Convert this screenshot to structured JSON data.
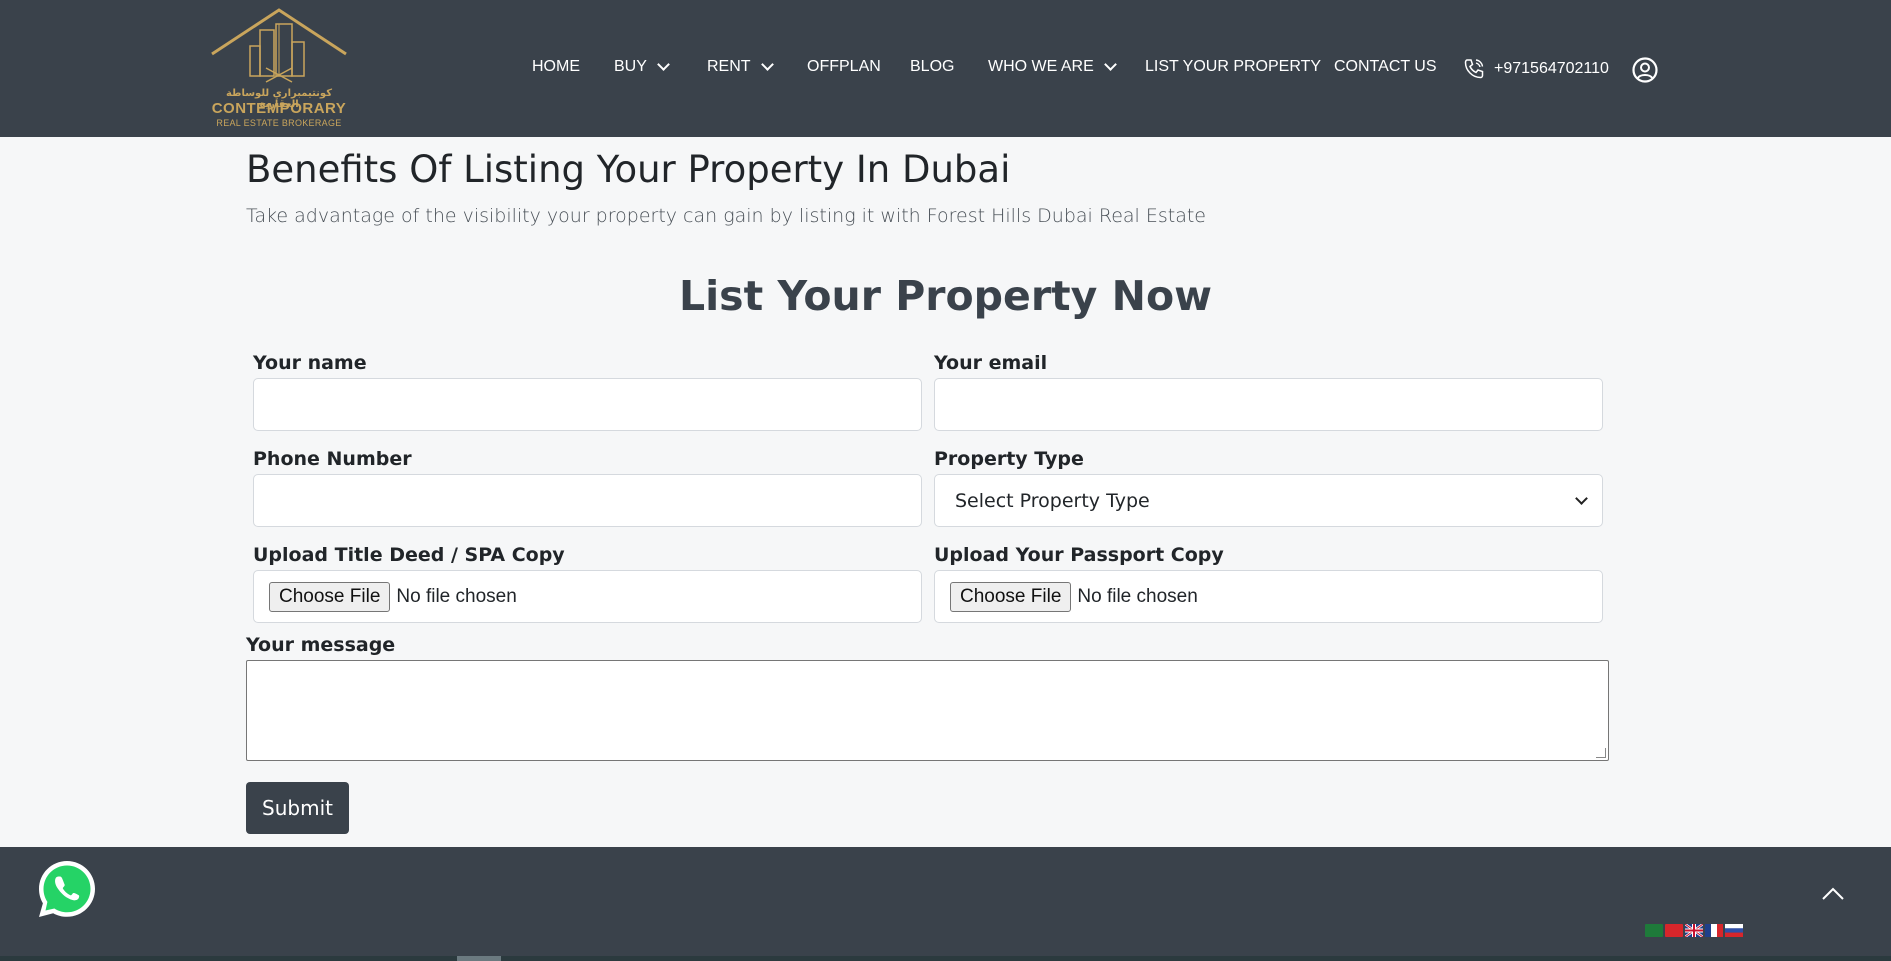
{
  "logo": {
    "arabic_text": "كونتيمبراري للوساطة العقارية",
    "main_text": "CONTEMPORARY",
    "sub_text": "REAL ESTATE BROKERAGE"
  },
  "nav": {
    "items": [
      {
        "label": "HOME",
        "dropdown": false
      },
      {
        "label": "BUY",
        "dropdown": true
      },
      {
        "label": "RENT",
        "dropdown": true
      },
      {
        "label": "OFFPLAN",
        "dropdown": false
      },
      {
        "label": "BLOG",
        "dropdown": false
      },
      {
        "label": "WHO WE ARE",
        "dropdown": true
      },
      {
        "label": "LIST YOUR PROPERTY",
        "dropdown": false
      },
      {
        "label": "CONTACT US",
        "dropdown": false
      }
    ],
    "phone": "+971564702110"
  },
  "main": {
    "heading": "Benefits Of Listing Your Property In Dubai",
    "subheading": "Take advantage of the visibility your property can gain by listing it with Forest Hills Dubai Real Estate",
    "form_title": "List Your Property Now"
  },
  "form": {
    "name_label": "Your name",
    "name_value": "",
    "email_label": "Your email",
    "email_value": "",
    "phone_label": "Phone Number",
    "phone_value": "",
    "property_type_label": "Property Type",
    "property_type_selected": "Select Property Type",
    "title_deed_label": "Upload Title Deed / SPA Copy",
    "passport_label": "Upload Your Passport Copy",
    "file_button": "Choose File",
    "file_status": "No file chosen",
    "message_label": "Your message",
    "message_value": "",
    "submit_label": "Submit"
  },
  "footer": {
    "languages": [
      "arabic-flag",
      "chinese-flag",
      "english-flag",
      "french-flag",
      "russian-flag"
    ]
  },
  "colors": {
    "header_bg": "#3a424b",
    "page_bg": "#f6f7f8",
    "gold": "#c9a55c",
    "whatsapp": "#25d366"
  }
}
